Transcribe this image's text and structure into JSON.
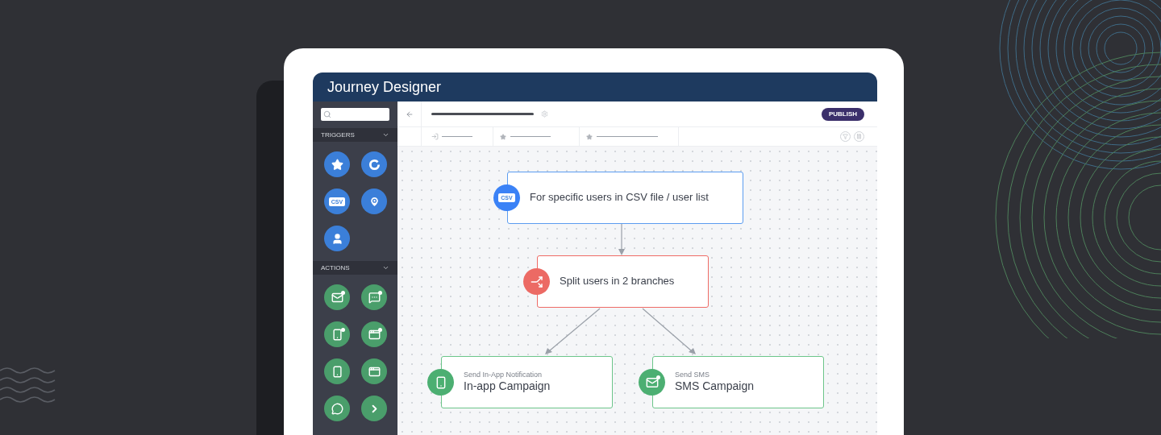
{
  "window": {
    "title": "Journey Designer"
  },
  "sidebar": {
    "sections": [
      {
        "label": "TRIGGERS",
        "kind": "trigger",
        "items": [
          {
            "kind": "star"
          },
          {
            "kind": "ring"
          },
          {
            "kind": "csv",
            "badge": "CSV"
          },
          {
            "kind": "pin"
          },
          {
            "kind": "user"
          }
        ]
      },
      {
        "label": "ACTIONS",
        "kind": "action",
        "items": [
          {
            "kind": "mail"
          },
          {
            "kind": "sms"
          },
          {
            "kind": "phone-dot"
          },
          {
            "kind": "window-dot"
          },
          {
            "kind": "phone"
          },
          {
            "kind": "window"
          },
          {
            "kind": "whatsapp"
          },
          {
            "kind": "next"
          }
        ]
      }
    ]
  },
  "toolbar": {
    "publish": "PUBLISH"
  },
  "canvas": {
    "nodes": [
      {
        "kind": "trigger",
        "badge": "CSV",
        "title": "For specific users in CSV file / user list"
      },
      {
        "kind": "condition",
        "title": "Split users in 2 branches"
      },
      {
        "kind": "action",
        "subtitle": "Send In-App Notification",
        "title": "In-app Campaign"
      },
      {
        "kind": "action",
        "subtitle": "Send SMS",
        "title": "SMS Campaign"
      }
    ]
  }
}
